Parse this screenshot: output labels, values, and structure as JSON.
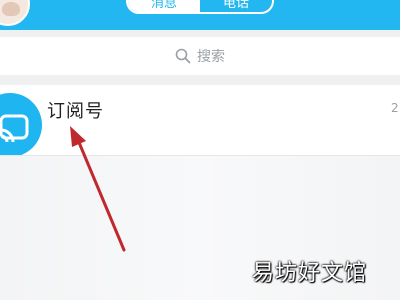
{
  "header": {
    "tabs": [
      {
        "label": "消息",
        "active": true
      },
      {
        "label": "电话",
        "active": false
      }
    ],
    "background_color": "#23b7f2"
  },
  "search": {
    "placeholder": "搜索",
    "icon": "search-icon"
  },
  "list": {
    "items": [
      {
        "title": "订阅号",
        "time": "2",
        "avatar_icon": "subscription-icon",
        "avatar_color": "#1fb5f0"
      }
    ]
  },
  "annotation": {
    "type": "arrow",
    "color": "#c0282d",
    "points_to": "list-item-subscription-title"
  },
  "watermark": {
    "text": "易坊好文馆"
  }
}
